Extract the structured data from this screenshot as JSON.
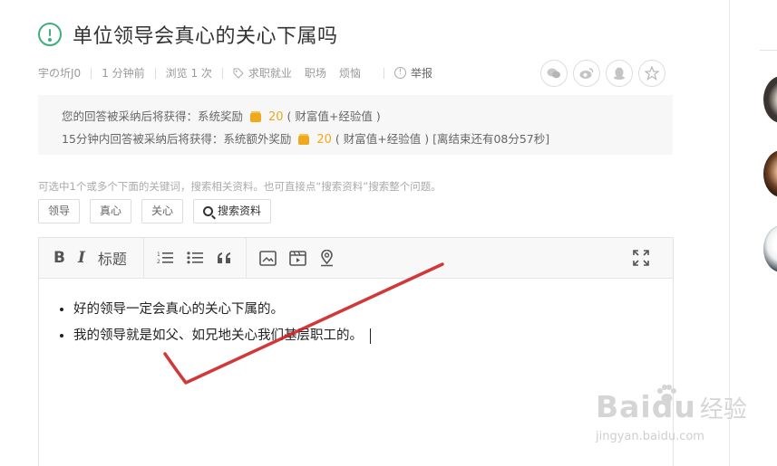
{
  "question": {
    "title": "单位领导会真心的关心下属吗"
  },
  "meta": {
    "author": "宇の圻J0",
    "time": "1 分钟前",
    "views": "浏览 1 次",
    "tags": [
      "求职就业",
      "职场",
      "烦恼"
    ],
    "report": "举报"
  },
  "share": {
    "icons": [
      "wechat-icon",
      "weibo-icon",
      "qq-icon",
      "favorite-star-icon"
    ]
  },
  "reward": {
    "line1_prefix": "您的回答被采纳后将获得：系统奖励",
    "line1_amount": "20",
    "line1_suffix": "( 财富值+经验值 )",
    "line2_prefix": "15分钟内回答被采纳后将获得：系统额外奖励",
    "line2_amount": "20",
    "line2_suffix": "( 财富值+经验值 ) [离结束还有08分57秒]",
    "colors": {
      "coin": "#f0a81c"
    }
  },
  "keywords": {
    "hint": "可选中1个或多个下面的关键词，搜索相关资料。也可直接点“搜索资料”搜索整个问题。",
    "items": [
      "领导",
      "真心",
      "关心"
    ],
    "search_label": "搜索资料"
  },
  "toolbar": {
    "bold": "B",
    "italic": "I",
    "heading": "标题",
    "icons": [
      "ordered-list-icon",
      "unordered-list-icon",
      "quote-icon",
      "image-icon",
      "video-icon",
      "location-icon",
      "fullscreen-icon"
    ]
  },
  "editor": {
    "lines": [
      "好的领导一定会真心的关心下属的。",
      "我的领导就是如父、如兄地关心我们基层职工的。"
    ]
  },
  "watermark": {
    "brand": "Baidu",
    "brand_cn": "经验",
    "url": "jingyan.baidu.com"
  },
  "colors": {
    "accent": "#3eaf7c",
    "annotation": "#cc2222"
  }
}
